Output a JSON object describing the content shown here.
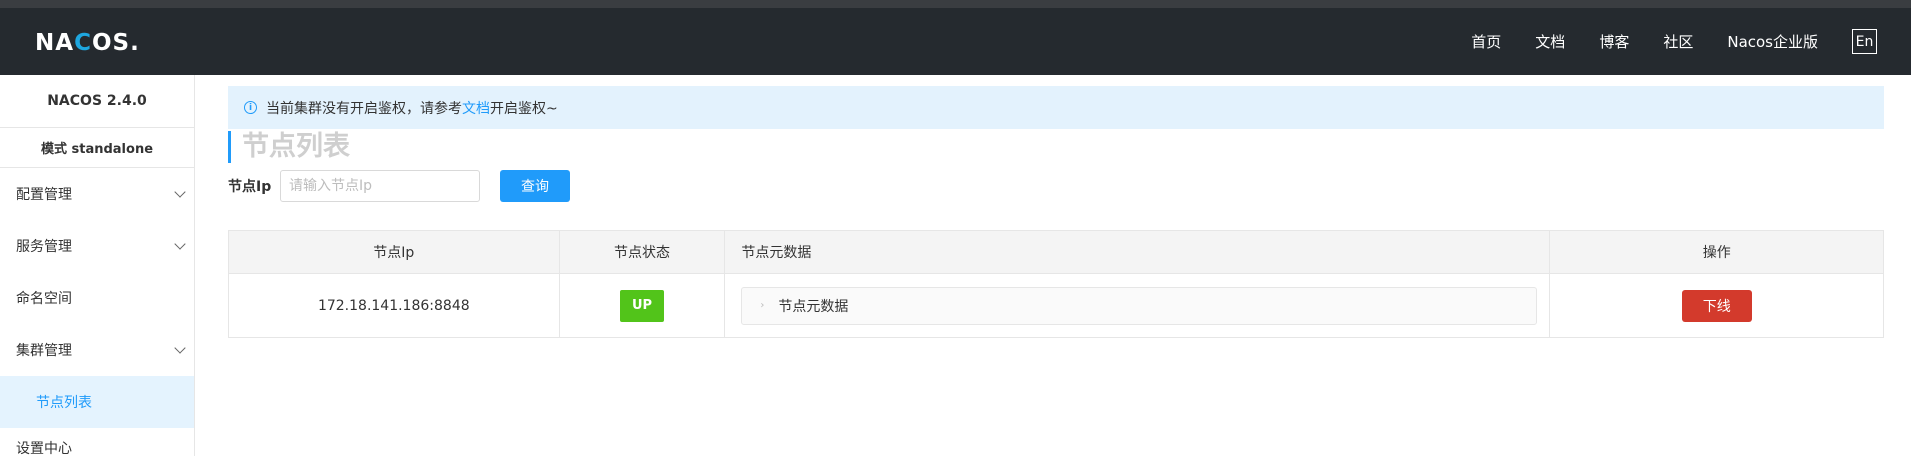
{
  "header": {
    "logo_text_1": "NA",
    "logo_text_2": "C",
    "logo_text_3": "OS.",
    "nav": [
      "首页",
      "文档",
      "博客",
      "社区",
      "Nacos企业版"
    ],
    "lang_label": "En"
  },
  "sidebar": {
    "version": "NACOS 2.4.0",
    "mode": "模式 standalone",
    "items": [
      {
        "label": "配置管理",
        "icon": "chevron-down-icon"
      },
      {
        "label": "服务管理",
        "icon": "chevron-down-icon"
      },
      {
        "label": "命名空间"
      },
      {
        "label": "集群管理",
        "icon": "chevron-down-icon"
      }
    ],
    "sub_active": "节点列表",
    "next_item_partial": "设置中心"
  },
  "notice": {
    "text_before": "当前集群没有开启鉴权，请参考",
    "link_text": "文档",
    "text_after": "开启鉴权~",
    "icon": "info-icon"
  },
  "page": {
    "title": "节点列表",
    "search_label": "节点Ip",
    "search_placeholder": "请输入节点Ip",
    "query_label": "查询"
  },
  "table": {
    "headers": [
      "节点Ip",
      "节点状态",
      "节点元数据",
      "操作"
    ],
    "rows": [
      {
        "ip": "172.18.141.186:8848",
        "status": "UP",
        "metadata": "节点元数据",
        "action": "下线"
      }
    ]
  },
  "colors": {
    "accent": "#209bfa",
    "header_bg": "#252a2f",
    "status_up": "#52c41a",
    "danger": "#d33a2c"
  }
}
